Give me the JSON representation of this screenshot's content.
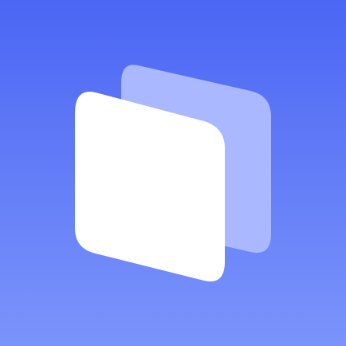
{
  "icon": {
    "name": "stacked-pages-icon",
    "colors": {
      "background_top": "#4b66f4",
      "background_bottom": "#7b94fb",
      "front_page": "#ffffff",
      "back_page": "#a9b8ff"
    }
  }
}
